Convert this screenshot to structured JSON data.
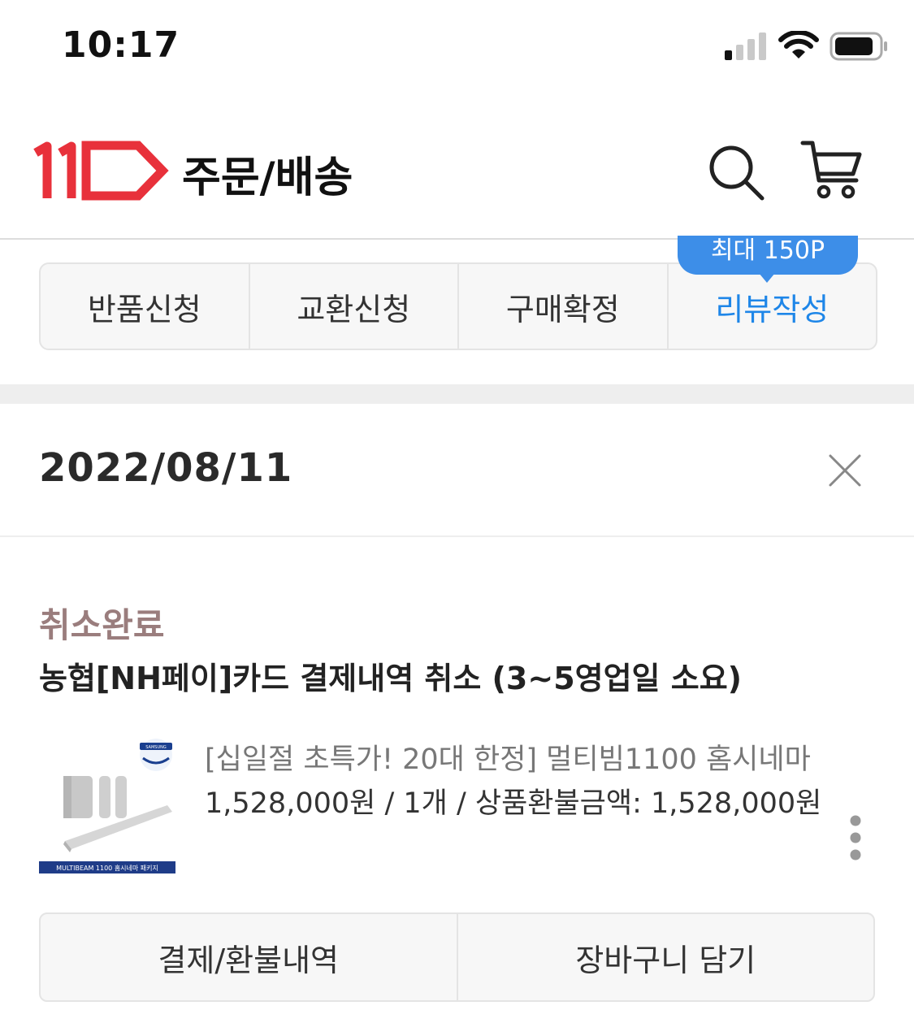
{
  "status_bar": {
    "time": "10:17"
  },
  "header": {
    "title": "주문/배송"
  },
  "action_tabs": [
    {
      "label": "반품신청"
    },
    {
      "label": "교환신청"
    },
    {
      "label": "구매확정"
    },
    {
      "label": "리뷰작성"
    }
  ],
  "review_badge": "최대 150P",
  "order": {
    "date": "2022/08/11",
    "status": "취소완료",
    "description": "농협[NH페이]카드 결제내역 취소 (3~5영업일 소요)",
    "product": {
      "name": "[십일절 초특가! 20대 한정] 멀티빔1100 홈시네마",
      "price_line": "1,528,000원 / 1개 / 상품환불금액: 1,528,000원",
      "thumb_brand": "SAMSUNG",
      "thumb_caption": "MULTIBEAM 1100 홈시네마 패키지"
    }
  },
  "bottom_actions": {
    "payment_history": "결제/환불내역",
    "add_to_cart": "장바구니 담기"
  },
  "colors": {
    "brand_red": "#e8313b",
    "active_blue": "#1e86e8",
    "status_brown": "#9a7d7d"
  }
}
